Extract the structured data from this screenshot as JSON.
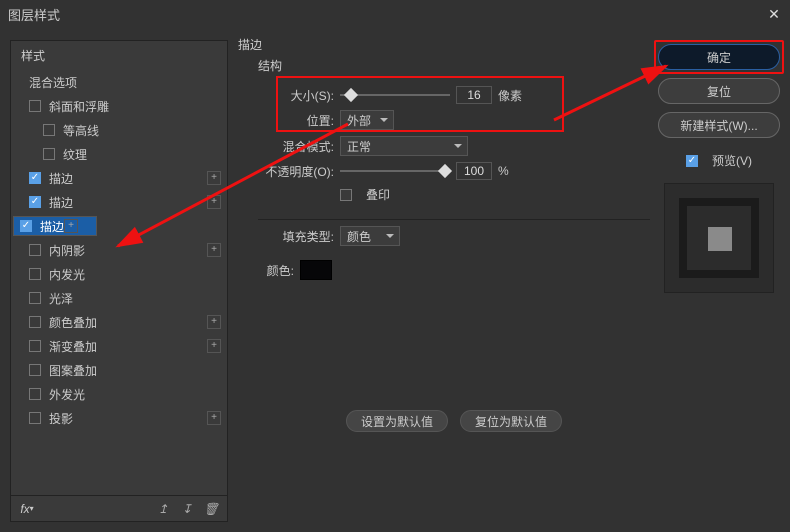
{
  "window": {
    "title": "图层样式"
  },
  "sidebar": {
    "header": "样式",
    "items": [
      {
        "label": "混合选项",
        "checkbox": false
      },
      {
        "label": "斜面和浮雕",
        "checked": false,
        "plus": false
      },
      {
        "label": "等高线",
        "checked": false,
        "sub": true
      },
      {
        "label": "纹理",
        "checked": false,
        "sub": true
      },
      {
        "label": "描边",
        "checked": true,
        "plus": true
      },
      {
        "label": "描边",
        "checked": true,
        "plus": true
      },
      {
        "label": "描边",
        "checked": true,
        "plus": true,
        "selected": true
      },
      {
        "label": "内阴影",
        "checked": false,
        "plus": true
      },
      {
        "label": "内发光",
        "checked": false
      },
      {
        "label": "光泽",
        "checked": false
      },
      {
        "label": "颜色叠加",
        "checked": false,
        "plus": true
      },
      {
        "label": "渐变叠加",
        "checked": false,
        "plus": true
      },
      {
        "label": "图案叠加",
        "checked": false
      },
      {
        "label": "外发光",
        "checked": false
      },
      {
        "label": "投影",
        "checked": false,
        "plus": true
      }
    ],
    "fx_label": "fx"
  },
  "panel": {
    "group_title": "描边",
    "struct_title": "结构",
    "size_label": "大小(S):",
    "size_value": "16",
    "size_unit": "像素",
    "position_label": "位置:",
    "position_value": "外部",
    "blend_label": "混合模式:",
    "blend_value": "正常",
    "opacity_label": "不透明度(O):",
    "opacity_value": "100",
    "opacity_unit": "%",
    "overprint_label": "叠印",
    "fill_type_label": "填充类型:",
    "fill_type_value": "颜色",
    "color_label": "颜色:",
    "btn_default": "设置为默认值",
    "btn_reset": "复位为默认值"
  },
  "rside": {
    "ok": "确定",
    "reset": "复位",
    "newstyle": "新建样式(W)...",
    "preview_label": "预览(V)"
  }
}
